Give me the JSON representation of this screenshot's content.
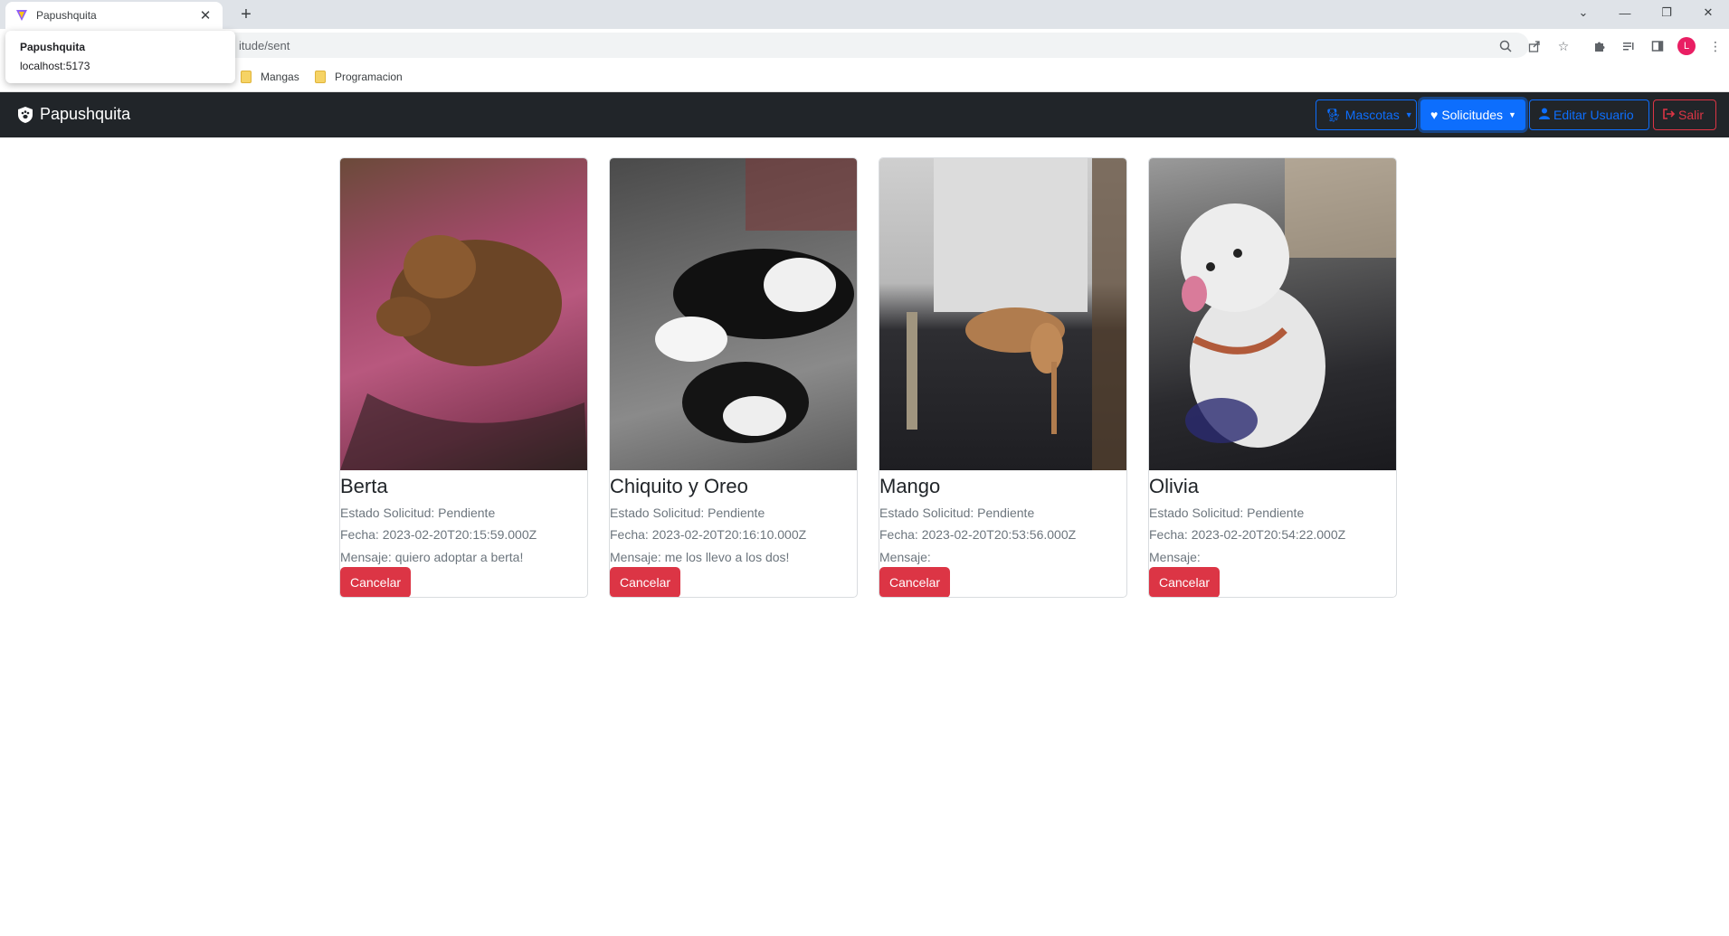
{
  "browser": {
    "tab_title": "Papushquita",
    "url": "itude/sent",
    "tooltip": {
      "title": "Papushquita",
      "host": "localhost:5173"
    },
    "bookmarks": [
      "Mangas",
      "Programacion"
    ],
    "profile_initial": "L"
  },
  "navbar": {
    "brand": "Papushquita",
    "buttons": {
      "mascotas": "Mascotas",
      "solicitudes": "Solicitudes",
      "editar_usuario": "Editar Usuario",
      "salir": "Salir"
    }
  },
  "cards": [
    {
      "name": "Berta",
      "estado": "Estado Solicitud: Pendiente",
      "fecha": "Fecha: 2023-02-20T20:15:59.000Z",
      "mensaje": "Mensaje: quiero adoptar a berta!",
      "button": "Cancelar"
    },
    {
      "name": "Chiquito y Oreo",
      "estado": "Estado Solicitud: Pendiente",
      "fecha": "Fecha: 2023-02-20T20:16:10.000Z",
      "mensaje": "Mensaje: me los llevo a los dos!",
      "button": "Cancelar"
    },
    {
      "name": "Mango",
      "estado": "Estado Solicitud: Pendiente",
      "fecha": "Fecha: 2023-02-20T20:53:56.000Z",
      "mensaje": "Mensaje:",
      "button": "Cancelar"
    },
    {
      "name": "Olivia",
      "estado": "Estado Solicitud: Pendiente",
      "fecha": "Fecha: 2023-02-20T20:54:22.000Z",
      "mensaje": "Mensaje:",
      "button": "Cancelar"
    }
  ],
  "colors": {
    "navbar_bg": "#212529",
    "primary": "#0d6efd",
    "danger": "#dc3545",
    "muted_text": "#6c757d"
  }
}
